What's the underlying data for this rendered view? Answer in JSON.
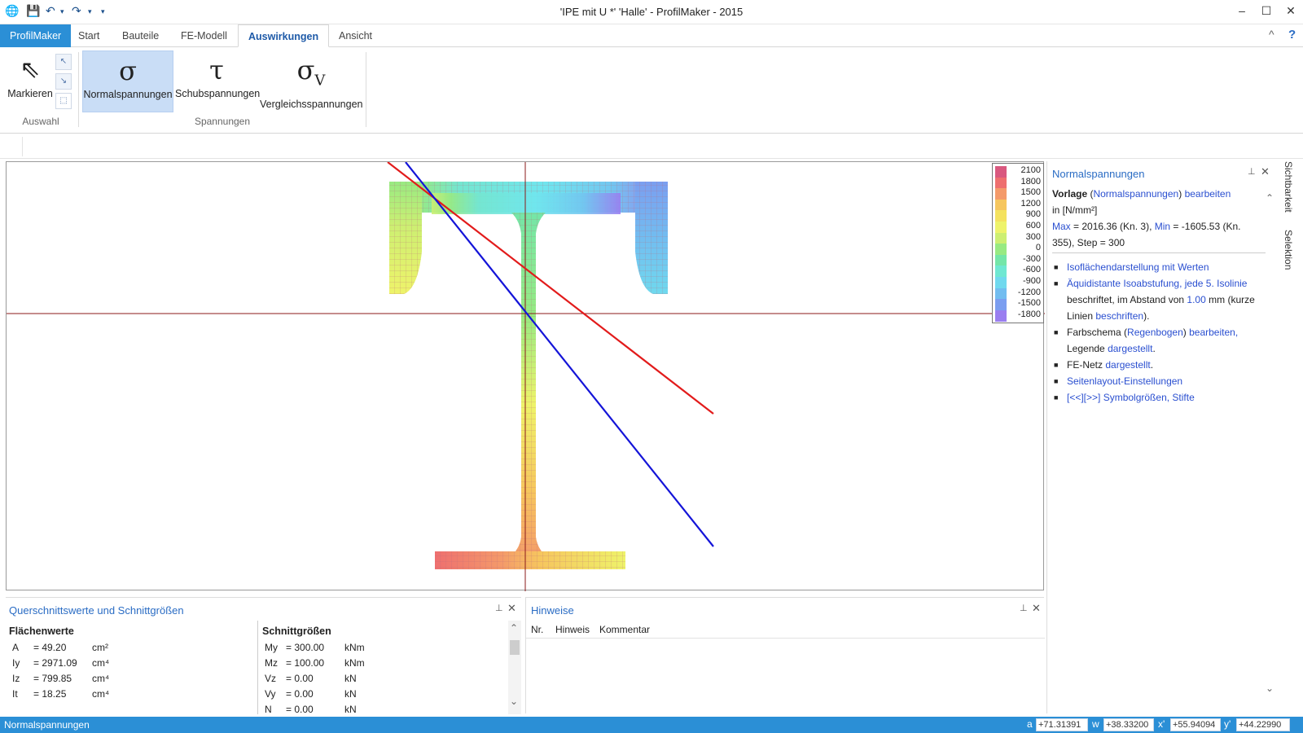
{
  "window": {
    "title": "'IPE mit U *' 'Halle' -  ProfilMaker - 2015",
    "minimize": "–",
    "maximize": "☐",
    "close": "✕"
  },
  "quick_access": {
    "app_icon": "globe-icon",
    "save_icon": "save-icon",
    "undo_icon": "undo-icon",
    "redo_icon": "redo-icon",
    "customize_icon": "dropdown-icon"
  },
  "tabs": [
    {
      "label": "ProfilMaker"
    },
    {
      "label": "Start"
    },
    {
      "label": "Bauteile"
    },
    {
      "label": "FE-Modell"
    },
    {
      "label": "Auswirkungen"
    },
    {
      "label": "Ansicht"
    }
  ],
  "ribbon": {
    "markieren": "Markieren",
    "auswahl_group": "Auswahl",
    "normal": {
      "symbol": "σ",
      "label": "Normalspannungen"
    },
    "schub": {
      "symbol": "τ",
      "label": "Schubspannungen"
    },
    "vergleich": {
      "symbol": "σ",
      "sub": "V",
      "label": "Vergleichsspannungen"
    },
    "spannungen_group": "Spannungen",
    "collapse": "^",
    "help": "?"
  },
  "legend": {
    "entries": [
      {
        "value": "2100",
        "color": "#d9587f"
      },
      {
        "value": "1800",
        "color": "#ee6f6f"
      },
      {
        "value": "1500",
        "color": "#f49a6a"
      },
      {
        "value": "1200",
        "color": "#f6c65e"
      },
      {
        "value": "900",
        "color": "#f4e25e"
      },
      {
        "value": "600",
        "color": "#eef36a"
      },
      {
        "value": "300",
        "color": "#cdef72"
      },
      {
        "value": "0",
        "color": "#98ea82"
      },
      {
        "value": "-300",
        "color": "#74e6a8"
      },
      {
        "value": "-600",
        "color": "#6fe8d2"
      },
      {
        "value": "-900",
        "color": "#70d9ee"
      },
      {
        "value": "-1200",
        "color": "#72bdf0"
      },
      {
        "value": "-1500",
        "color": "#7b9ef0"
      },
      {
        "value": "-1800",
        "color": "#9a7ef0"
      }
    ]
  },
  "right_panel": {
    "title": "Normalspannungen",
    "vorlage_label": "Vorlage",
    "vorlage_name": "Normalspannungen",
    "bearbeiten": "bearbeiten",
    "unit": "in [N/mm²]",
    "max_label": "Max",
    "max_value": " = 2016.36 (Kn. 3), ",
    "min_label": "Min",
    "min_value": " = -1605.53 (Kn. 355), Step = 300",
    "b1": "Isoflächendarstellung mit Werten",
    "b2_link": "Äquidistante Isoabstufung, jede 5. Isolinie",
    "b2_text": " beschriftet, im Abstand von ",
    "b2_value": "1.00",
    "b2_unit": " mm",
    "b2_paren_open": "(kurze Linien ",
    "b2_link2": "beschriften",
    "b2_paren_close": ").",
    "b3_text": "Farbschema (",
    "b3_link": "Regenbogen",
    "b3_text2": ") ",
    "b3_link2": "bearbeiten,",
    "b3_text3": "Legende ",
    "b3_link3": "dargestellt",
    "b3_text4": ".",
    "b4_text": "FE-Netz ",
    "b4_link": "dargestellt",
    "b4_text2": ".",
    "b5": "Seitenlayout-Einstellungen",
    "b6": "[<<][>>] Symbolgrößen, Stifte",
    "side_tab1": "Sichtbarkeit",
    "side_tab2": "Selektion"
  },
  "q_panel": {
    "title": "Querschnittswerte und Schnittgrößen",
    "flaechen_title": "Flächenwerte",
    "flaechen": [
      {
        "name": "A",
        "value": "= 49.20",
        "unit": "cm²"
      },
      {
        "name": "Iy",
        "value": "= 2971.09",
        "unit": "cm⁴"
      },
      {
        "name": "Iz",
        "value": "= 799.85",
        "unit": "cm⁴"
      },
      {
        "name": "It",
        "value": "= 18.25",
        "unit": "cm⁴"
      }
    ],
    "schnitt_title": "Schnittgrößen",
    "schnitt": [
      {
        "name": "My",
        "value": "= 300.00",
        "unit": "kNm"
      },
      {
        "name": "Mz",
        "value": "= 100.00",
        "unit": "kNm"
      },
      {
        "name": "Vz",
        "value": "= 0.00",
        "unit": "kN"
      },
      {
        "name": "Vy",
        "value": "= 0.00",
        "unit": "kN"
      },
      {
        "name": "N",
        "value": "= 0.00",
        "unit": "kN"
      }
    ]
  },
  "h_panel": {
    "title": "Hinweise",
    "col_nr": "Nr.",
    "col_hinweis": "Hinweis",
    "col_kommentar": "Kommentar"
  },
  "status": {
    "text": "Normalspannungen",
    "a_label": "a",
    "a_value": "+71.31391",
    "w_label": "w",
    "w_value": "+38.33200",
    "x_label": "x'",
    "x_value": "+55.94094",
    "y_label": "y'",
    "y_value": "+44.22990"
  },
  "colors": {
    "accent": "#2b8fd6",
    "red_line": "#e21b1b",
    "blue_line": "#1414d8",
    "axis": "#8b1a1a"
  }
}
